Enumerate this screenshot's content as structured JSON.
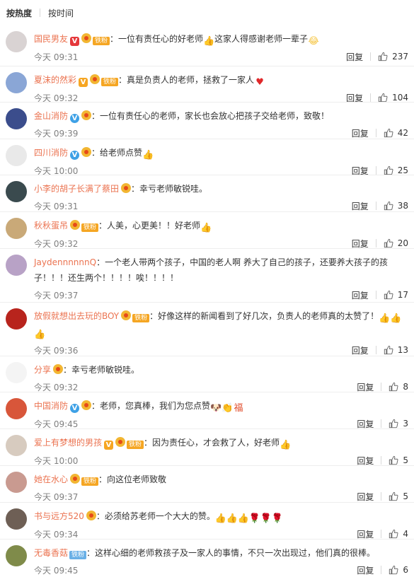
{
  "tabs": {
    "hot": "按热度",
    "time": "按时间"
  },
  "labels": {
    "reply": "回复"
  },
  "colors": {
    "accent": "#eb7350",
    "fan_badge": "#f5a623",
    "verified_orange": "#f6a623",
    "verified_blue": "#3ea1e6"
  },
  "comments": [
    {
      "user": "国民男友",
      "badges": [
        "verified-red",
        "level",
        "fan"
      ],
      "text": "：一位有责任心的好老师",
      "text2": "这家人得感谢老师一辈子",
      "emojis": [
        "thumb-icon"
      ],
      "emojis2": [
        "laugh-icon"
      ],
      "time": "今天 09:31",
      "likes": "237",
      "avatar": "#d9d3d3"
    },
    {
      "user": "夏沫的然彩",
      "badges": [
        "verified-orange",
        "level",
        "fan"
      ],
      "text": "：真是负责人的老师，拯救了一家人",
      "emojis": [
        "heart-icon"
      ],
      "time": "今天 09:32",
      "likes": "104",
      "avatar": "#8aa6d6"
    },
    {
      "user": "金山消防",
      "badges": [
        "verified-blue",
        "level"
      ],
      "text": "：一位有责任心的老师，家长也会放心把孩子交给老师，致敬！",
      "time": "今天 09:39",
      "likes": "42",
      "avatar": "#3b4d8c"
    },
    {
      "user": "四川消防",
      "badges": [
        "verified-blue",
        "level"
      ],
      "text": "：给老师点赞",
      "emojis": [
        "thumb-icon"
      ],
      "time": "今天 10:00",
      "likes": "25",
      "avatar": "#e9e9e9"
    },
    {
      "user": "小李的胡子长满了蔡田",
      "badges": [
        "level"
      ],
      "text": "：幸亏老师敏锐哇。",
      "time": "今天 09:31",
      "likes": "38",
      "avatar": "#3a4a4e"
    },
    {
      "user": "秋秋蛋吊",
      "badges": [
        "level",
        "fan"
      ],
      "text": "：人美，心更美！！好老师",
      "emojis": [
        "thumb-icon"
      ],
      "time": "今天 09:32",
      "likes": "20",
      "avatar": "#c9a978"
    },
    {
      "user": "JaydennnnnnQ",
      "badges": [],
      "text": "：一个老人带两个孩子，中国的老人啊 养大了自己的孩子，还要养大孩子的孩子！！！还生两个！！！！唉！！！！",
      "time": "今天 09:37",
      "likes": "17",
      "avatar": "#b8a2c6"
    },
    {
      "user": "放假就想出去玩的BOY",
      "badges": [
        "level",
        "fan"
      ],
      "text": "：好像这样的新闻看到了好几次，负责人的老师真的太赞了！",
      "emojis": [
        "thumb-icon",
        "thumb-icon",
        "thumb-icon"
      ],
      "time": "今天 09:36",
      "likes": "13",
      "avatar": "#b8241d"
    },
    {
      "user": "分享",
      "badges": [
        "level"
      ],
      "text": "：幸亏老师敏锐哇。",
      "time": "今天 09:32",
      "likes": "8",
      "avatar": "#f4f4f4"
    },
    {
      "user": "中国消防",
      "badges": [
        "verified-blue",
        "level"
      ],
      "text": "：老师，您真棒，我们为您点赞",
      "emojis": [
        "dog-icon",
        "hands-icon",
        "fu-icon"
      ],
      "time": "今天 09:45",
      "likes": "3",
      "avatar": "#d8563a"
    },
    {
      "user": "爱上有梦想的男孩",
      "badges": [
        "verified-orange",
        "level",
        "fan"
      ],
      "text": "：因为责任心，才会救了人，好老师",
      "emojis": [
        "thumb-icon"
      ],
      "time": "今天 10:00",
      "likes": "5",
      "avatar": "#d7cbbf"
    },
    {
      "user": "她在水心",
      "badges": [
        "level",
        "fan"
      ],
      "text": "：向这位老师致敬",
      "time": "今天 09:37",
      "likes": "5",
      "avatar": "#c99a90"
    },
    {
      "user": "书与远方520",
      "badges": [
        "level"
      ],
      "text": "：必须给苏老师一个大大的赞。",
      "emojis": [
        "thumb-icon",
        "thumb-icon",
        "thumb-icon",
        "rose-icon",
        "rose-icon",
        "rose-icon"
      ],
      "time": "今天 09:34",
      "likes": "4",
      "avatar": "#6e5f55"
    },
    {
      "user": "无毒香菇",
      "badges": [
        "fan-blue"
      ],
      "text": "：这样心细的老师救孩子及一家人的事情，不只一次出现过，他们真的很棒。",
      "time": "今天 09:45",
      "likes": "6",
      "avatar": "#7f8b4a"
    }
  ],
  "fan_label": "铁粉",
  "verified_v": "V"
}
